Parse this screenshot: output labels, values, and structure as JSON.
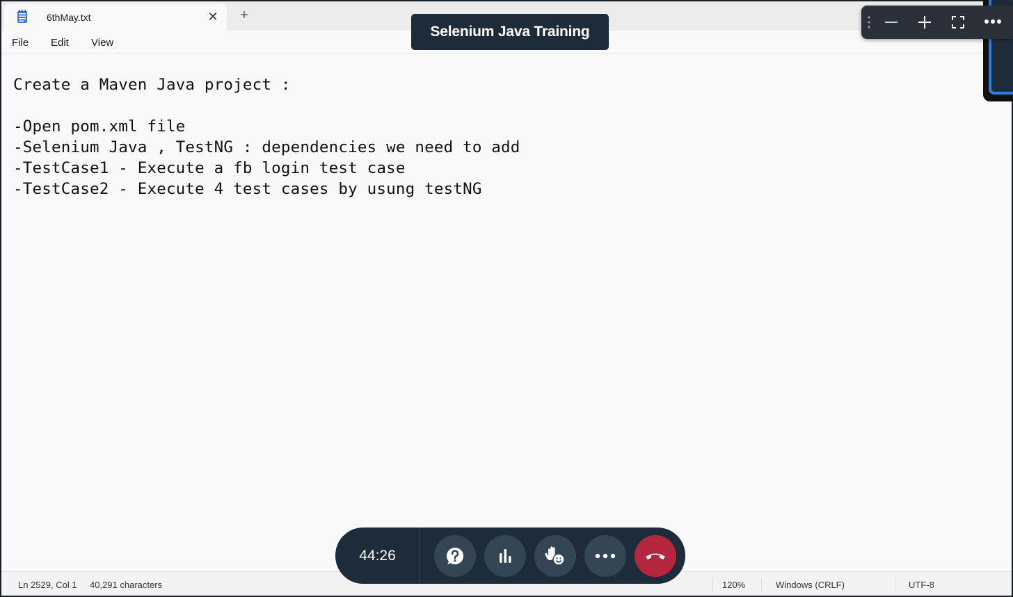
{
  "tab": {
    "title": "6thMay.txt",
    "close_label": "✕",
    "add_label": "+"
  },
  "menu": {
    "file": "File",
    "edit": "Edit",
    "view": "View"
  },
  "editor": {
    "lines": [
      "Create a Maven Java project :",
      "",
      "-Open pom.xml file",
      "-Selenium Java , TestNG : dependencies we need to add",
      "-TestCase1 - Execute a fb login test case",
      "-TestCase2 - Execute 4 test cases by usung testNG"
    ]
  },
  "status": {
    "position": "Ln 2529, Col 1",
    "characters": "40,291 characters",
    "zoom": "120%",
    "line_ending": "Windows (CRLF)",
    "encoding": "UTF-8"
  },
  "meeting": {
    "title": "Selenium Java Training"
  },
  "call": {
    "timer": "44:26",
    "buttons": [
      "help-icon",
      "poll-icon",
      "raise-hand-icon",
      "more-icon",
      "hang-up-icon"
    ]
  },
  "colors": {
    "call_bar": "#1e2b3a",
    "call_button": "#344556",
    "hang_up": "#b3263e",
    "accent": "#2b7fe0"
  }
}
